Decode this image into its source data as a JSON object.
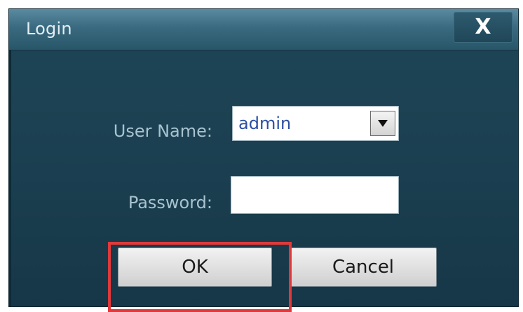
{
  "window": {
    "title": "Login",
    "close_label": "X"
  },
  "form": {
    "username_label": "User Name:",
    "username_value": "admin",
    "password_label": "Password:",
    "password_value": ""
  },
  "buttons": {
    "ok_label": "OK",
    "cancel_label": "Cancel"
  },
  "colors": {
    "highlight": "#e0393b",
    "dialog_bg": "#1b3f50",
    "titlebar": "#3a6a80"
  },
  "icons": {
    "close": "close-icon",
    "dropdown": "dropdown-arrow-icon"
  }
}
